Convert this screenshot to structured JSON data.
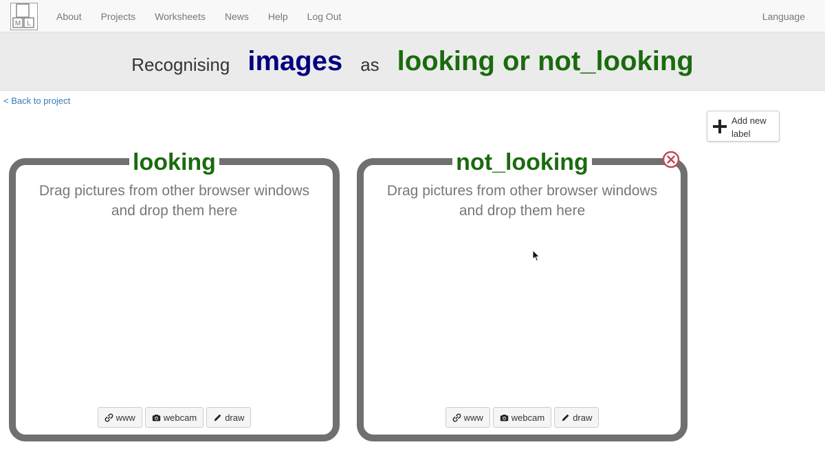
{
  "navbar": {
    "logo_letters": [
      "M",
      "L"
    ],
    "items": [
      "About",
      "Projects",
      "Worksheets",
      "News",
      "Help",
      "Log Out"
    ],
    "language": "Language"
  },
  "header": {
    "prefix": "Recognising",
    "data_type": "images",
    "middle": "as",
    "labels_phrase": "looking or not_looking"
  },
  "back_link": "< Back to project",
  "add_label_button": "Add new label",
  "boxes": [
    {
      "title": "looking",
      "hint_line1": "Drag pictures from other browser windows",
      "hint_line2": "and drop them here",
      "buttons": [
        "www",
        "webcam",
        "draw"
      ]
    },
    {
      "title": "not_looking",
      "hint_line1": "Drag pictures from other browser windows",
      "hint_line2": "and drop them here",
      "buttons": [
        "www",
        "webcam",
        "draw"
      ]
    }
  ],
  "colors": {
    "title_green": "#1a6b0e",
    "datatype_blue": "#000080",
    "delete_red": "#c0485a",
    "box_border": "#707070",
    "link_blue": "#337ab7"
  }
}
